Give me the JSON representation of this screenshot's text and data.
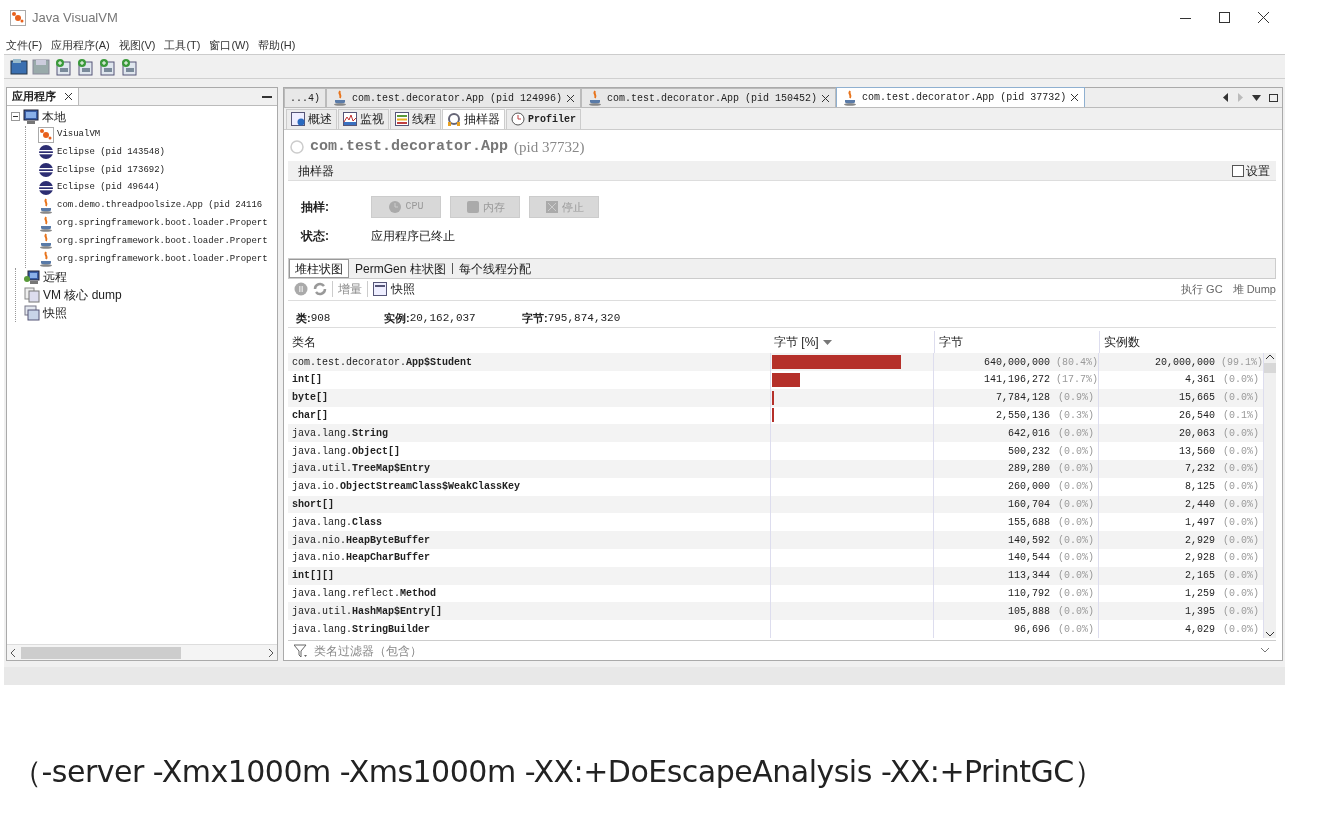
{
  "window": {
    "title": "Java VisualVM"
  },
  "menu": [
    "文件(F)",
    "应用程序(A)",
    "视图(V)",
    "工具(T)",
    "窗口(W)",
    "帮助(H)"
  ],
  "sidebar": {
    "title": "应用程序",
    "items": [
      {
        "label": "本地",
        "kind": "computer",
        "expanded": true,
        "children": [
          {
            "label": "VisualVM",
            "kind": "visualvm"
          },
          {
            "label": "Eclipse (pid 143548)",
            "kind": "eclipse"
          },
          {
            "label": "Eclipse (pid 173692)",
            "kind": "eclipse"
          },
          {
            "label": "Eclipse (pid 49644)",
            "kind": "eclipse"
          },
          {
            "label": "com.demo.threadpoolsize.App (pid 24116",
            "kind": "java"
          },
          {
            "label": "org.springframework.boot.loader.Propert",
            "kind": "java"
          },
          {
            "label": "org.springframework.boot.loader.Propert",
            "kind": "java"
          },
          {
            "label": "org.springframework.boot.loader.Propert",
            "kind": "java"
          }
        ]
      },
      {
        "label": "远程",
        "kind": "remote"
      },
      {
        "label": "VM 核心 dump",
        "kind": "dump"
      },
      {
        "label": "快照",
        "kind": "snapshot"
      }
    ]
  },
  "doc_tabs": [
    {
      "label": "...4)",
      "kind": "overflow",
      "selected": false
    },
    {
      "label": "com.test.decorator.App (pid 124996)",
      "kind": "app",
      "selected": false
    },
    {
      "label": "com.test.decorator.App (pid 150452)",
      "kind": "app",
      "selected": false
    },
    {
      "label": "com.test.decorator.App (pid 37732)",
      "kind": "app",
      "selected": true
    }
  ],
  "view_tabs": [
    {
      "label": "概述",
      "kind": "overview",
      "selected": false
    },
    {
      "label": "监视",
      "kind": "monitor",
      "selected": false
    },
    {
      "label": "线程",
      "kind": "threads",
      "selected": false
    },
    {
      "label": "抽样器",
      "kind": "sampler",
      "selected": true
    },
    {
      "label": "Profiler",
      "kind": "profiler",
      "selected": false
    }
  ],
  "heading": {
    "name": "com.test.decorator.App",
    "pid": "(pid 37732)"
  },
  "section": {
    "title": "抽样器",
    "settings": {
      "label": "设置",
      "checked": false
    }
  },
  "sample": {
    "label": "抽样:",
    "buttons": [
      {
        "label": "CPU",
        "kind": "cpu",
        "disabled": true
      },
      {
        "label": "内存",
        "kind": "memory",
        "disabled": true
      },
      {
        "label": "停止",
        "kind": "stop",
        "disabled": true
      }
    ]
  },
  "status": {
    "label": "状态:",
    "value": "应用程序已终止"
  },
  "sub_tabs": [
    {
      "label": "堆柱状图",
      "selected": true
    },
    {
      "label": "PermGen 柱状图",
      "selected": false
    },
    {
      "label": "每个线程分配",
      "selected": false
    }
  ],
  "heap_toolbar": {
    "buttons": [
      {
        "label": "增量",
        "kind": "delta"
      },
      {
        "label": "快照",
        "kind": "snapshot"
      }
    ],
    "actions": [
      "执行 GC",
      "堆 Dump"
    ]
  },
  "stats": [
    {
      "label": "类:",
      "value": "908"
    },
    {
      "label": "实例:",
      "value": "20,162,037"
    },
    {
      "label": "字节:",
      "value": "795,874,320"
    }
  ],
  "table": {
    "columns": [
      "类名",
      "字节 [%]",
      "字节",
      "实例数"
    ],
    "rows": [
      {
        "name": "com.test.decorator.**App$Student**",
        "level": 0.804,
        "bytes": "640,000,000",
        "bytes_pct": "(80.4%)",
        "instances": "20,000,000",
        "instances_pct": "(99.1%)"
      },
      {
        "name": "**int[]**",
        "level": 0.177,
        "bytes": "141,196,272",
        "bytes_pct": "(17.7%)",
        "instances": "4,361",
        "instances_pct": "(0.0%)"
      },
      {
        "name": "**byte[]**",
        "level": 0.009,
        "bytes": "7,784,128",
        "bytes_pct": "(0.9%)",
        "instances": "15,665",
        "instances_pct": "(0.0%)"
      },
      {
        "name": "**char[]**",
        "level": 0.003,
        "bytes": "2,550,136",
        "bytes_pct": "(0.3%)",
        "instances": "26,540",
        "instances_pct": "(0.1%)"
      },
      {
        "name": "java.lang.**String**",
        "bytes": "642,016",
        "bytes_pct": "(0.0%)",
        "instances": "20,063",
        "instances_pct": "(0.0%)"
      },
      {
        "name": "java.lang.**Object[]**",
        "bytes": "500,232",
        "bytes_pct": "(0.0%)",
        "instances": "13,560",
        "instances_pct": "(0.0%)"
      },
      {
        "name": "java.util.**TreeMap$Entry**",
        "bytes": "289,280",
        "bytes_pct": "(0.0%)",
        "instances": "7,232",
        "instances_pct": "(0.0%)"
      },
      {
        "name": "java.io.**ObjectStreamClass$WeakClassKey**",
        "bytes": "260,000",
        "bytes_pct": "(0.0%)",
        "instances": "8,125",
        "instances_pct": "(0.0%)"
      },
      {
        "name": "**short[]**",
        "bytes": "160,704",
        "bytes_pct": "(0.0%)",
        "instances": "2,440",
        "instances_pct": "(0.0%)"
      },
      {
        "name": "java.lang.**Class**",
        "bytes": "155,688",
        "bytes_pct": "(0.0%)",
        "instances": "1,497",
        "instances_pct": "(0.0%)"
      },
      {
        "name": "java.nio.**HeapByteBuffer**",
        "bytes": "140,592",
        "bytes_pct": "(0.0%)",
        "instances": "2,929",
        "instances_pct": "(0.0%)"
      },
      {
        "name": "java.nio.**HeapCharBuffer**",
        "bytes": "140,544",
        "bytes_pct": "(0.0%)",
        "instances": "2,928",
        "instances_pct": "(0.0%)"
      },
      {
        "name": "**int[][]**",
        "bytes": "113,344",
        "bytes_pct": "(0.0%)",
        "instances": "2,165",
        "instances_pct": "(0.0%)"
      },
      {
        "name": "java.lang.reflect.**Method**",
        "bytes": "110,792",
        "bytes_pct": "(0.0%)",
        "instances": "1,259",
        "instances_pct": "(0.0%)"
      },
      {
        "name": "java.util.**HashMap$Entry[]**",
        "bytes": "105,888",
        "bytes_pct": "(0.0%)",
        "instances": "1,395",
        "instances_pct": "(0.0%)"
      },
      {
        "name": "java.lang.**StringBuilder**",
        "bytes": "96,696",
        "bytes_pct": "(0.0%)",
        "instances": "4,029",
        "instances_pct": "(0.0%)"
      }
    ]
  },
  "filter": {
    "placeholder": "类名过滤器（包含）"
  },
  "caption": "（-server -Xmx1000m -Xms1000m -XX:+DoEscapeAnalysis -XX:+PrintGC）"
}
